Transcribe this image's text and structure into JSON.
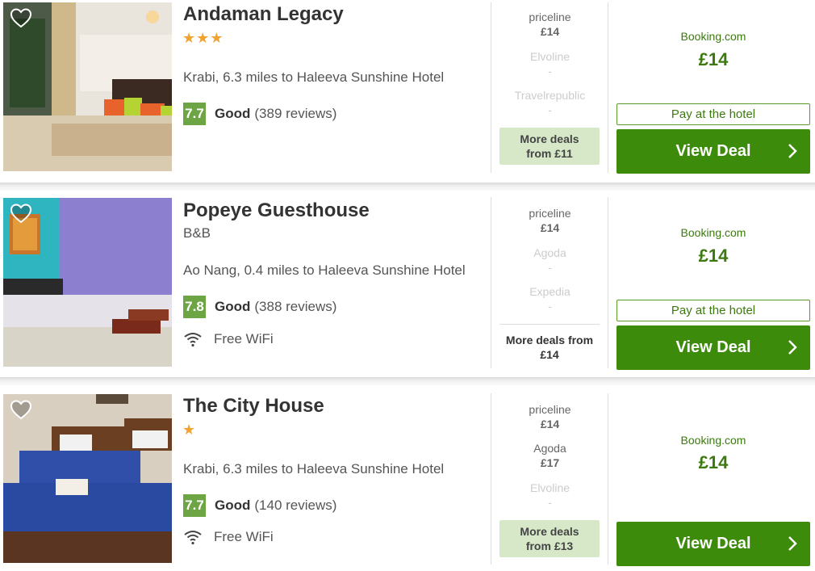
{
  "hotels": [
    {
      "name": "Andaman Legacy",
      "stars": "★★★",
      "location": "Krabi, 6.3 miles to Haleeva Sunshine Hotel",
      "score": "7.7",
      "score_label": "Good",
      "reviews": "(389 reviews)",
      "offers": [
        {
          "provider": "priceline",
          "price": "£14"
        },
        {
          "provider": "Elvoline",
          "price": "-"
        },
        {
          "provider": "Travelrepublic",
          "price": "-"
        }
      ],
      "more_deals": "More deals from £11",
      "best_site": "Booking.com",
      "best_price": "£14",
      "pay_label": "Pay at the hotel",
      "deal_label": "View Deal"
    },
    {
      "name": "Popeye Guesthouse",
      "type": "B&B",
      "location": "Ao Nang, 0.4 miles to Haleeva Sunshine Hotel",
      "score": "7.8",
      "score_label": "Good",
      "reviews": "(388 reviews)",
      "amenity": "Free WiFi",
      "offers": [
        {
          "provider": "priceline",
          "price": "£14"
        },
        {
          "provider": "Agoda",
          "price": "-"
        },
        {
          "provider": "Expedia",
          "price": "-"
        }
      ],
      "more_deals": "More deals from £14",
      "best_site": "Booking.com",
      "best_price": "£14",
      "pay_label": "Pay at the hotel",
      "deal_label": "View Deal"
    },
    {
      "name": "The City House",
      "stars": "★",
      "location": "Krabi, 6.3 miles to Haleeva Sunshine Hotel",
      "score": "7.7",
      "score_label": "Good",
      "reviews": "(140 reviews)",
      "amenity": "Free WiFi",
      "offers": [
        {
          "provider": "priceline",
          "price": "£14"
        },
        {
          "provider": "Agoda",
          "price": "£17"
        },
        {
          "provider": "Elvoline",
          "price": "-"
        }
      ],
      "more_deals": "More deals from £13",
      "best_site": "Booking.com",
      "best_price": "£14",
      "deal_label": "View Deal"
    }
  ],
  "colors": {
    "score": "#6da544",
    "deal_button": "#3c8b0a",
    "price": "#3c7a0f",
    "more_box": "#d6e8c8"
  },
  "icons": {
    "favorite": "heart-icon",
    "wifi": "wifi-icon",
    "chevron": "chevron-right-icon"
  }
}
